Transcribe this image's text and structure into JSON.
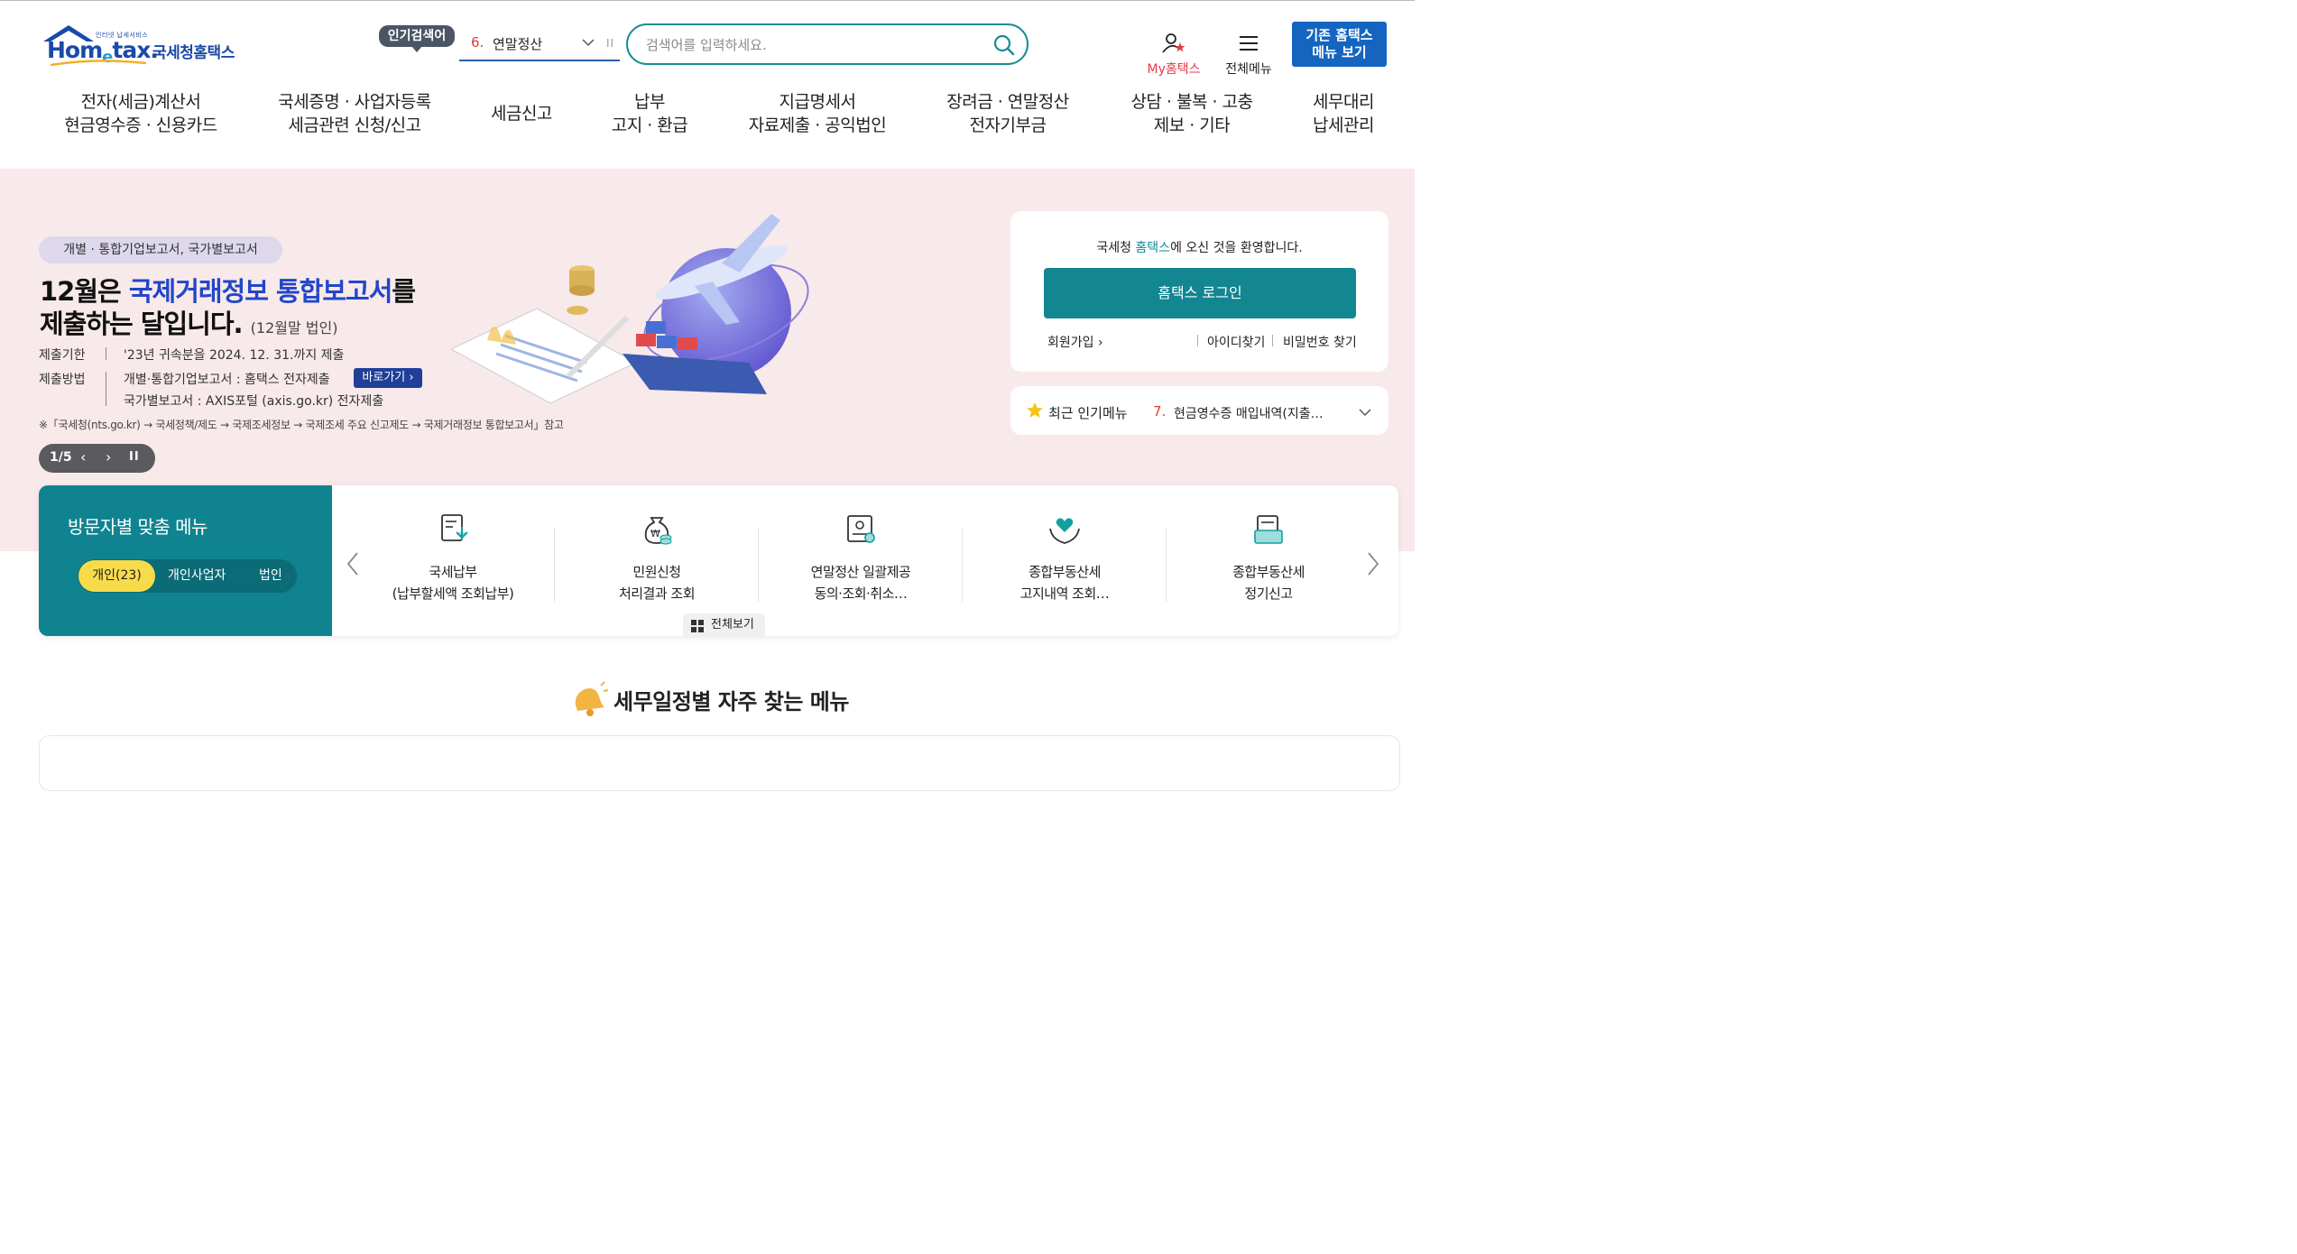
{
  "logo": {
    "tagline": "인터넷 납세서비스",
    "brand": "Hometax",
    "korean_name": "국세청홈택스"
  },
  "popular_search": {
    "badge": "인기검색어",
    "rank": "6.",
    "term": "연말정산"
  },
  "search": {
    "placeholder": "검색어를 입력하세요."
  },
  "header": {
    "my_hometax": "My홈택스",
    "all_menu": "전체메뉴",
    "old_menu_line1": "기존 홈택스",
    "old_menu_line2": "메뉴 보기"
  },
  "nav": [
    {
      "line1": "전자(세금)계산서",
      "line2": "현금영수증 · 신용카드"
    },
    {
      "line1": "국세증명 · 사업자등록",
      "line2": "세금관련 신청/신고"
    },
    {
      "line1": "세금신고",
      "line2": ""
    },
    {
      "line1": "납부",
      "line2": "고지 · 환급"
    },
    {
      "line1": "지급명세서",
      "line2": "자료제출 · 공익법인"
    },
    {
      "line1": "장려금 · 연말정산",
      "line2": "전자기부금"
    },
    {
      "line1": "상담 · 불복 · 고충",
      "line2": "제보 · 기타"
    },
    {
      "line1": "세무대리",
      "line2": "납세관리"
    }
  ],
  "hero": {
    "pill": "개별 · 통합기업보고서, 국가별보고서",
    "title1_pre": "12월은 ",
    "title1_hl": "국제거래정보 통합보고서",
    "title1_post": "를",
    "title2": "제출하는 달입니다.",
    "title2_small": "(12월말 법인)",
    "deadline_key": "제출기한",
    "deadline_val": "'23년 귀속분을 2024. 12. 31.까지 제출",
    "method_key": "제출방법",
    "method_val1": "개별·통합기업보고서 : 홈택스 전자제출",
    "method_btn": "바로가기 ›",
    "method_val2": "국가별보고서 : AXIS포털 (axis.go.kr) 전자제출",
    "note": "※「국세청(nts.go.kr) → 국세정책/제도 → 국제조세정보 → 국제조세 주요 신고제도 → 국제거래정보 통합보고서」참고",
    "pager_count": "1/5"
  },
  "login": {
    "welcome_pre": "국세청 ",
    "welcome_hl": "홈택스",
    "welcome_post": "에 오신 것을 환영합니다.",
    "button": "홈택스 로그인",
    "join": "회원가입",
    "find_id": "아이디찾기",
    "find_pw": "비밀번호 찾기"
  },
  "recent_popular": {
    "label": "최근 인기메뉴",
    "rank": "7.",
    "term": "현금영수증 매입내역(지출…"
  },
  "visitor_menu": {
    "title": "방문자별 맞춤 메뉴",
    "tabs": [
      "개인(23)",
      "개인사업자",
      "법인"
    ],
    "active_tab": "개인(23)",
    "services": [
      {
        "icon": "tax-document-icon",
        "line1": "국세납부",
        "line2": "(납부할세액 조회납부)"
      },
      {
        "icon": "money-bag-icon",
        "line1": "민원신청",
        "line2": "처리결과 조회"
      },
      {
        "icon": "certificate-icon",
        "line1": "연말정산 일괄제공",
        "line2": "동의·조회·취소…"
      },
      {
        "icon": "heart-hands-icon",
        "line1": "종합부동산세",
        "line2": "고지내역 조회…"
      },
      {
        "icon": "folder-icon",
        "line1": "종합부동산세",
        "line2": "정기신고"
      }
    ],
    "view_all": "전체보기"
  },
  "section": {
    "title": "세무일정별 자주 찾는 메뉴"
  },
  "colors": {
    "brand_teal": "#108390",
    "login_button": "#128691",
    "old_menu_blue": "#1565c0",
    "hero_bg": "#f8e9ea",
    "tab_active_yellow": "#f7db4a",
    "accent_red": "#e03a3a"
  }
}
